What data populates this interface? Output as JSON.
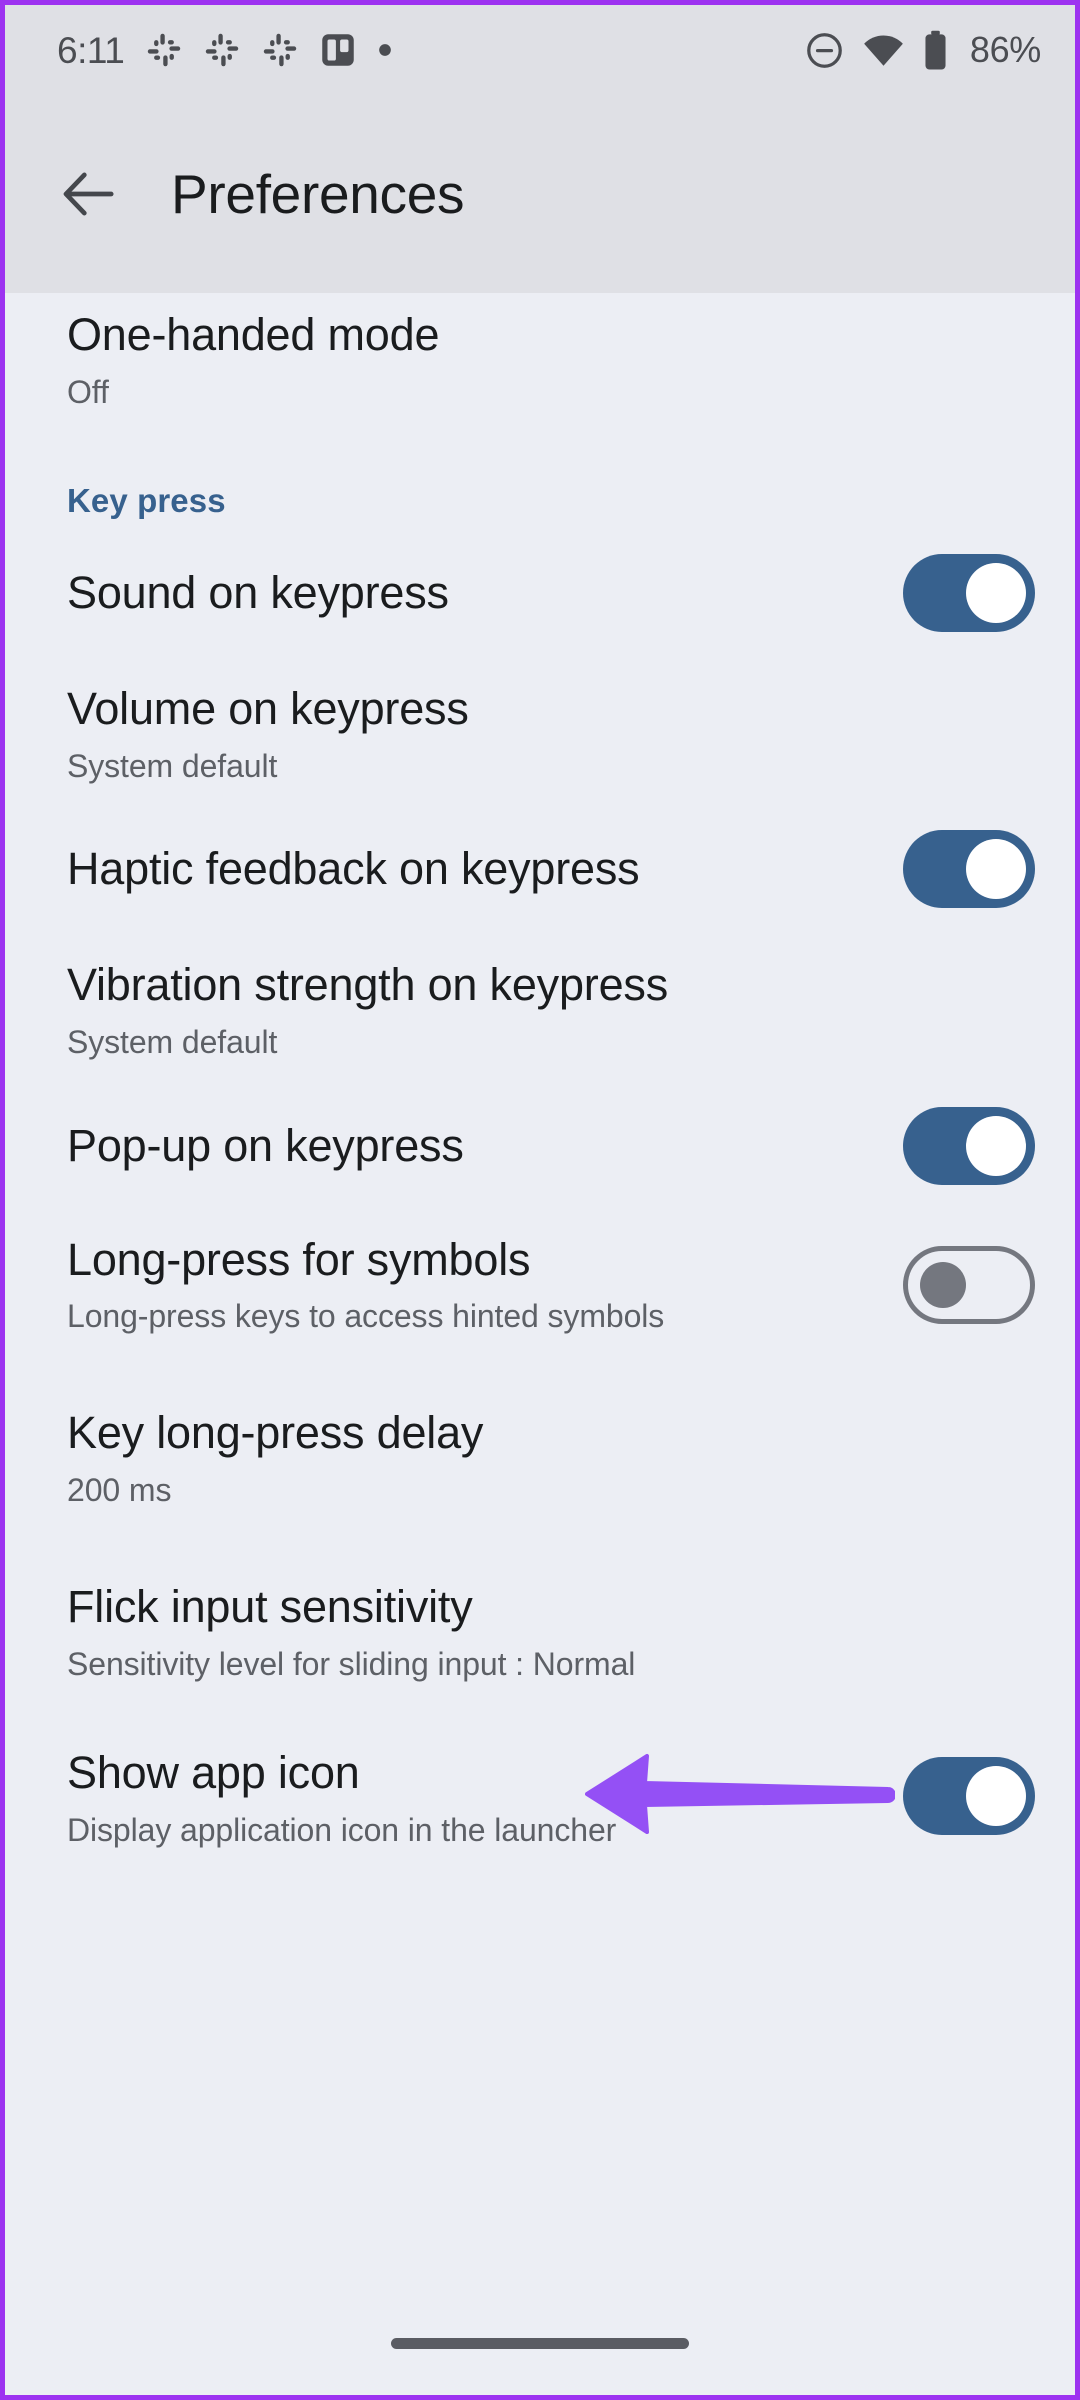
{
  "status_bar": {
    "time": "6:11",
    "notification_icons": [
      "slack-icon",
      "slack-icon",
      "slack-icon",
      "trello-icon",
      "dot-icon"
    ],
    "right_icons": [
      "do-not-disturb-icon",
      "wifi-icon",
      "battery-icon"
    ],
    "battery_percent": "86%"
  },
  "app_bar": {
    "back_icon": "back-arrow-icon",
    "title": "Preferences"
  },
  "colors": {
    "accent": "#37618e",
    "annotation": "#9450f5",
    "status_bg": "#dfe0e5",
    "page_bg": "#eceef4",
    "title_text": "#1a1c1e",
    "sub_text": "#5d6066"
  },
  "annotation": {
    "type": "arrow",
    "direction": "left",
    "points_at": "Key long-press delay",
    "color": "#9450f5"
  },
  "settings": [
    {
      "name": "one-handed-mode",
      "title": "One-handed mode",
      "subtitle": "Off",
      "control": "none"
    },
    {
      "name": "key-press-section",
      "title": "Key press",
      "control": "section-header"
    },
    {
      "name": "sound-on-keypress",
      "title": "Sound on keypress",
      "subtitle": "",
      "control": "switch",
      "switch_state": "on"
    },
    {
      "name": "volume-on-keypress",
      "title": "Volume on keypress",
      "subtitle": "System default",
      "control": "none"
    },
    {
      "name": "haptic-feedback-on-keypress",
      "title": "Haptic feedback on keypress",
      "subtitle": "",
      "control": "switch",
      "switch_state": "on"
    },
    {
      "name": "vibration-strength-on-keypress",
      "title": "Vibration strength on keypress",
      "subtitle": "System default",
      "control": "none"
    },
    {
      "name": "popup-on-keypress",
      "title": "Pop-up on keypress",
      "subtitle": "",
      "control": "switch",
      "switch_state": "on"
    },
    {
      "name": "long-press-for-symbols",
      "title": "Long-press for symbols",
      "subtitle": "Long-press keys to access hinted symbols",
      "control": "switch",
      "switch_state": "off"
    },
    {
      "name": "key-long-press-delay",
      "title": "Key long-press delay",
      "subtitle": "200 ms",
      "control": "none"
    },
    {
      "name": "flick-input-sensitivity",
      "title": "Flick input sensitivity",
      "subtitle": "Sensitivity level for sliding input : Normal",
      "control": "none"
    },
    {
      "name": "show-app-icon",
      "title": "Show app icon",
      "subtitle": "Display application icon in the launcher",
      "control": "switch",
      "switch_state": "on"
    }
  ],
  "nav": {
    "gesture_bar": "home-gesture-bar"
  }
}
